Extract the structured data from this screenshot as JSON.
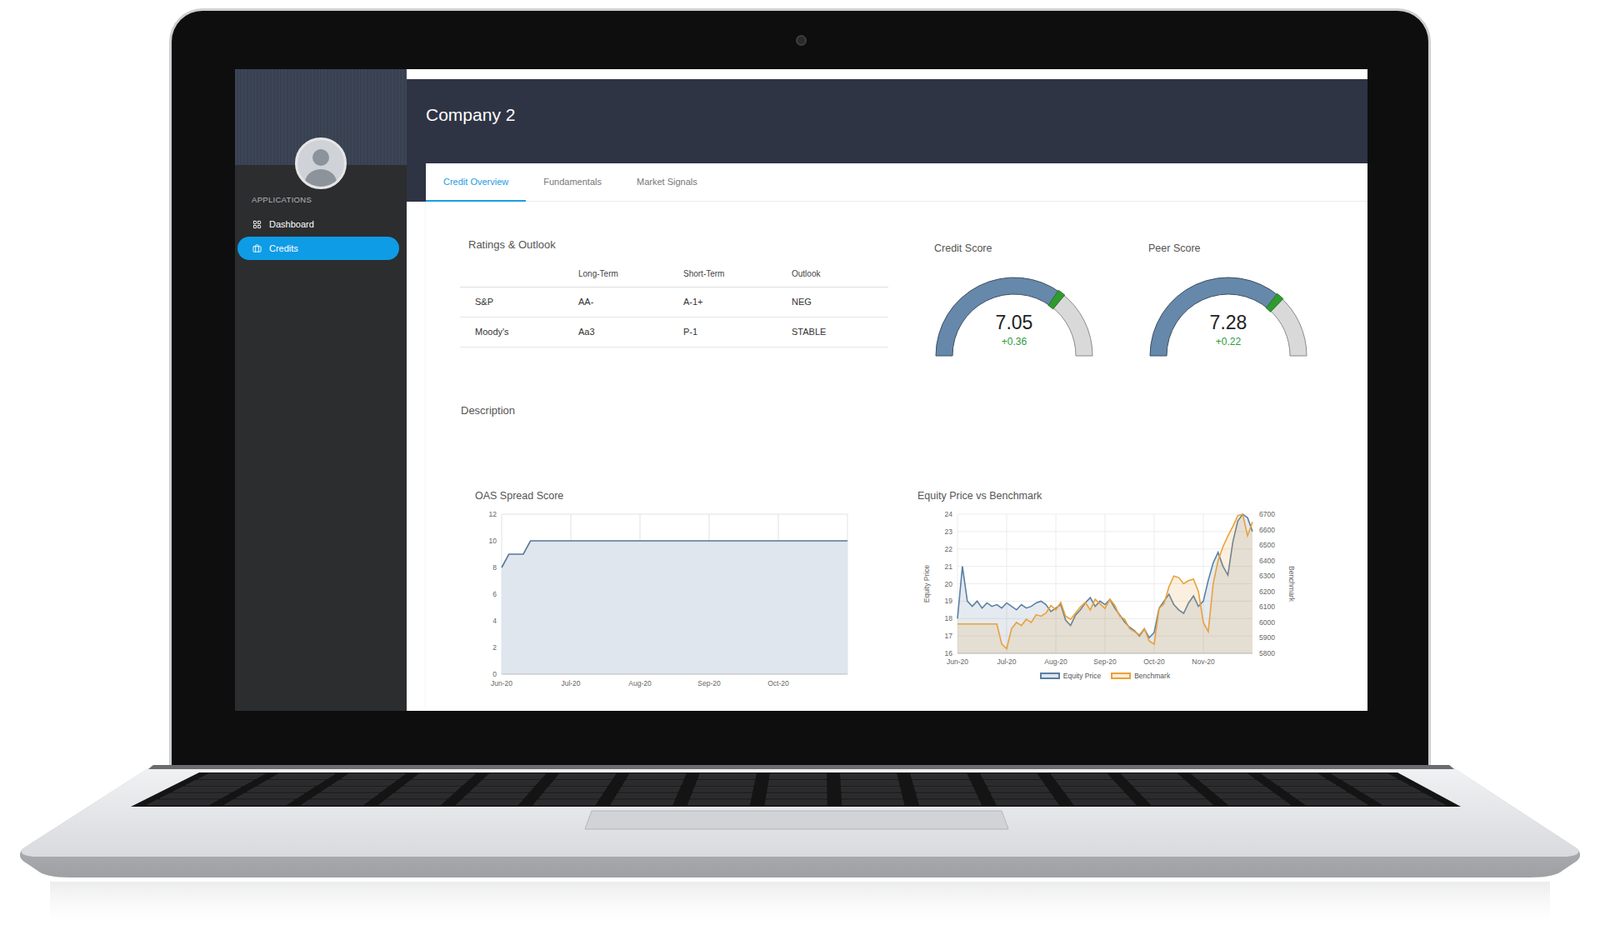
{
  "window": {
    "title": "Company 2"
  },
  "sidebar": {
    "section": "APPLICATIONS",
    "items": [
      {
        "label": "Dashboard",
        "selected": false
      },
      {
        "label": "Credits",
        "selected": true
      }
    ]
  },
  "tabs": [
    {
      "label": "Credit Overview",
      "selected": true
    },
    {
      "label": "Fundamentals",
      "selected": false
    },
    {
      "label": "Market Signals",
      "selected": false
    }
  ],
  "ratings": {
    "title": "Ratings & Outlook",
    "columns": [
      "",
      "Long-Term",
      "Short-Term",
      "Outlook"
    ],
    "rows": [
      [
        "S&P",
        "AA-",
        "A-1+",
        "NEG"
      ],
      [
        "Moody's",
        "Aa3",
        "P-1",
        "STABLE"
      ]
    ]
  },
  "gauges": [
    {
      "title": "Credit Score",
      "value": "7.05",
      "change": "+0.36",
      "level": 0.705
    },
    {
      "title": "Peer Score",
      "value": "7.28",
      "change": "+0.22",
      "level": 0.728
    }
  ],
  "description": {
    "label": "Description"
  },
  "oas_chart": {
    "title": "OAS Spread Score",
    "y_ticks": [
      "0",
      "2",
      "4",
      "6",
      "8",
      "10",
      "12"
    ],
    "x_ticks": [
      "Jun-20",
      "Jul-20",
      "Aug-20",
      "Sep-20",
      "Oct-20"
    ],
    "values": [
      8,
      9,
      9,
      9,
      10,
      10,
      10,
      10,
      10,
      10,
      10,
      10,
      10,
      10,
      10,
      10,
      10,
      10,
      10,
      10,
      10,
      10,
      10,
      10,
      10,
      10,
      10,
      10,
      10,
      10,
      10,
      10,
      10,
      10,
      10,
      10,
      10,
      10,
      10,
      10,
      10,
      10,
      10,
      10,
      10,
      10,
      10,
      10,
      10
    ]
  },
  "equity_chart": {
    "title": "Equity Price vs Benchmark",
    "left_axis": {
      "label": "Equity Price",
      "ticks": [
        "16",
        "17",
        "18",
        "19",
        "20",
        "21",
        "22",
        "23",
        "24"
      ]
    },
    "right_axis": {
      "label": "Benchmark",
      "ticks": [
        "5800",
        "5900",
        "6000",
        "6100",
        "6200",
        "6300",
        "6400",
        "6500",
        "6600",
        "6700"
      ]
    },
    "x_ticks": [
      "Jun-20",
      "Jul-20",
      "Aug-20",
      "Sep-20",
      "Oct-20",
      "Nov-20"
    ],
    "series": [
      {
        "name": "Equity Price",
        "color": "#5b7fa3",
        "axis": "left",
        "values": [
          18.0,
          21.0,
          19.0,
          18.7,
          19.0,
          18.6,
          18.9,
          18.7,
          18.8,
          18.6,
          18.9,
          18.7,
          18.5,
          18.8,
          18.6,
          18.7,
          18.9,
          19.0,
          18.8,
          18.4,
          18.6,
          18.8,
          17.9,
          17.6,
          18.2,
          18.5,
          18.9,
          19.2,
          18.7,
          19.0,
          18.8,
          19.1,
          18.6,
          18.2,
          17.8,
          17.5,
          17.3,
          17.0,
          17.4,
          16.9,
          17.2,
          18.6,
          19.0,
          19.4,
          18.8,
          18.5,
          18.3,
          18.9,
          19.3,
          18.7,
          19.0,
          20.2,
          21.2,
          21.8,
          21.0,
          20.5,
          22.4,
          23.6,
          24.0,
          23.8,
          23.0
        ]
      },
      {
        "name": "Benchmark",
        "color": "#e8a23a",
        "axis": "right",
        "values": [
          5990,
          5990,
          5990,
          5990,
          5990,
          5990,
          5990,
          5990,
          5990,
          5860,
          5830,
          5960,
          6000,
          5980,
          6020,
          6000,
          6050,
          6040,
          6060,
          6110,
          6080,
          6130,
          6040,
          6020,
          6060,
          6100,
          6130,
          6080,
          6150,
          6120,
          6090,
          6150,
          6110,
          6040,
          6020,
          5960,
          5940,
          5920,
          5960,
          5880,
          5860,
          6090,
          6120,
          6230,
          6300,
          6290,
          6250,
          6270,
          6280,
          6200,
          6000,
          5940,
          6250,
          6400,
          6490,
          6560,
          6620,
          6690,
          6700,
          6560,
          6650
        ]
      }
    ]
  }
}
